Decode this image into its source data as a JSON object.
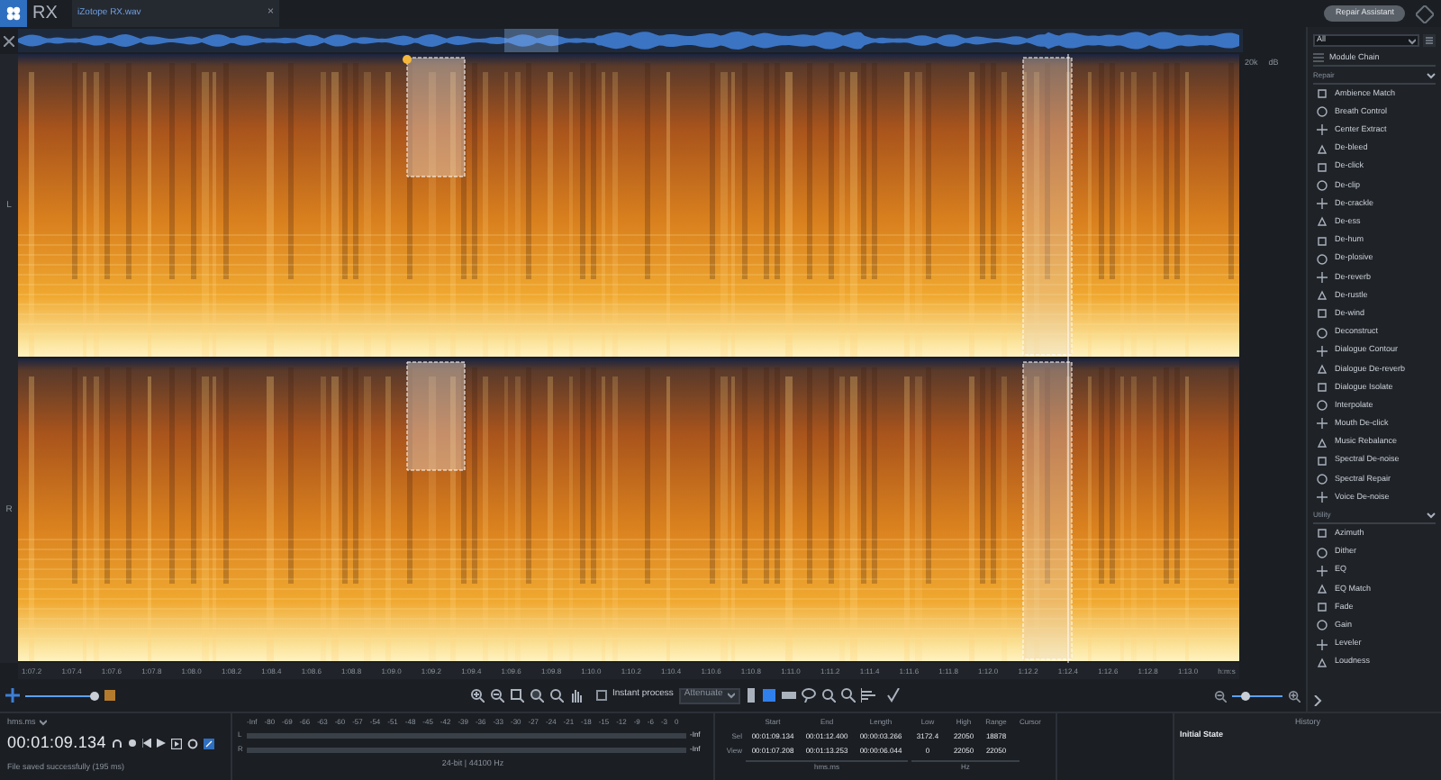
{
  "app": {
    "logo": "RX",
    "tab": {
      "label": "iZotope RX.wav",
      "close": "×"
    },
    "repair_assistant": "Repair Assistant"
  },
  "spectrogram": {
    "channels": [
      "L",
      "R"
    ],
    "axis_labels": [
      "20k",
      "dB"
    ]
  },
  "timeline": [
    "1:07.2",
    "1:07.4",
    "1:07.6",
    "1:07.8",
    "1:08.0",
    "1:08.2",
    "1:08.4",
    "1:08.6",
    "1:08.8",
    "1:09.0",
    "1:09.2",
    "1:09.4",
    "1:09.6",
    "1:09.8",
    "1:10.0",
    "1:10.2",
    "1:10.4",
    "1:10.6",
    "1:10.8",
    "1:11.0",
    "1:11.2",
    "1:11.4",
    "1:11.6",
    "1:11.8",
    "1:12.0",
    "1:12.2",
    "1:12.4",
    "1:12.6",
    "1:12.8",
    "1:13.0",
    "h:m:s"
  ],
  "toolbar": {
    "zoom": {
      "level": 0.95
    },
    "frequency_zoom": {
      "level": 0.25
    },
    "instant_process": {
      "label": "Instant process",
      "checked": false
    },
    "mode": "Attenuate"
  },
  "modules": {
    "filter": "All",
    "module_chain": "Module Chain",
    "sections": [
      {
        "title": "Repair",
        "expanded": true,
        "items": [
          "Ambience Match",
          "Breath Control",
          "Center Extract",
          "De-bleed",
          "De-click",
          "De-clip",
          "De-crackle",
          "De-ess",
          "De-hum",
          "De-plosive",
          "De-reverb",
          "De-rustle",
          "De-wind",
          "Deconstruct",
          "Dialogue Contour",
          "Dialogue De-reverb",
          "Dialogue Isolate",
          "Interpolate",
          "Mouth De-click",
          "Music Rebalance",
          "Spectral De-noise",
          "Spectral Repair",
          "Voice De-noise"
        ]
      },
      {
        "title": "Utility",
        "expanded": true,
        "items": [
          "Azimuth",
          "Dither",
          "EQ",
          "EQ Match",
          "Fade",
          "Gain",
          "Leveler",
          "Loudness"
        ]
      }
    ]
  },
  "transport": {
    "format": "hms.ms",
    "time": "00:01:09.134",
    "status": "File saved successfully (195 ms)"
  },
  "meter": {
    "scale": [
      "-Inf",
      "-80",
      "-69",
      "-66",
      "-63",
      "-60",
      "-57",
      "-54",
      "-51",
      "-48",
      "-45",
      "-42",
      "-39",
      "-36",
      "-33",
      "-30",
      "-27",
      "-24",
      "-21",
      "-18",
      "-15",
      "-12",
      "-9",
      "-6",
      "-3",
      "0"
    ],
    "channels": [
      {
        "label": "L",
        "reading": "-Inf"
      },
      {
        "label": "R",
        "reading": "-Inf"
      }
    ],
    "format": "24-bit | 44100 Hz"
  },
  "selection": {
    "columns": [
      "Start",
      "End",
      "Length",
      "Low",
      "High",
      "Range",
      "Cursor"
    ],
    "rows": [
      {
        "label": "Sel",
        "values": [
          "00:01:09.134",
          "00:01:12.400",
          "00:00:03.266",
          "3172.4",
          "22050",
          "18878"
        ]
      },
      {
        "label": "View",
        "values": [
          "00:01:07.208",
          "00:01:13.253",
          "00:00:06.044",
          "0",
          "22050",
          "22050"
        ]
      }
    ],
    "units": [
      "hms.ms",
      "Hz"
    ]
  },
  "history": {
    "title": "History",
    "items": [
      "Initial State"
    ]
  }
}
